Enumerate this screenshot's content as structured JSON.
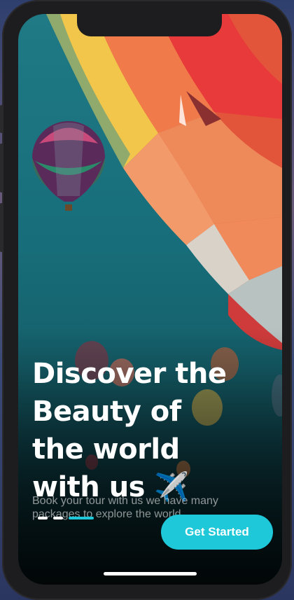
{
  "onboarding": {
    "headline_lines": [
      "Discover the",
      "Beauty of",
      "the world",
      "with us"
    ],
    "headline_emoji": "✈️",
    "subtitle": "Book your tour with us we have many packages to explore the world",
    "pager": {
      "count": 3,
      "active_index": 2
    },
    "cta_label": "Get Started"
  },
  "colors": {
    "accent": "#1ec8d8",
    "sky": "#1f7a86",
    "text": "#ffffff"
  },
  "icons": [
    "airplane-icon",
    "hot-air-balloon"
  ]
}
